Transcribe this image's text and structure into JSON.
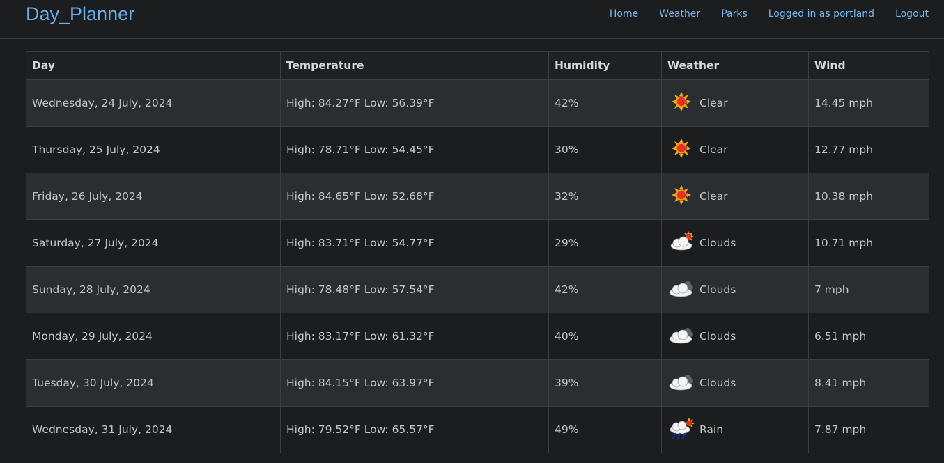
{
  "app": {
    "brand": "Day_Planner",
    "nav": [
      "Home",
      "Weather",
      "Parks",
      "Logged in as portland",
      "Logout"
    ]
  },
  "table": {
    "headers": [
      "Day",
      "Temperature",
      "Humidity",
      "Weather",
      "Wind"
    ],
    "rows": [
      {
        "day": "Wednesday, 24 July, 2024",
        "temp": "High: 84.27°F Low: 56.39°F",
        "humidity": "42%",
        "icon": "sun-icon",
        "weather": "Clear",
        "wind": "14.45 mph"
      },
      {
        "day": "Thursday, 25 July, 2024",
        "temp": "High: 78.71°F Low: 54.45°F",
        "humidity": "30%",
        "icon": "sun-icon",
        "weather": "Clear",
        "wind": "12.77 mph"
      },
      {
        "day": "Friday, 26 July, 2024",
        "temp": "High: 84.65°F Low: 52.68°F",
        "humidity": "32%",
        "icon": "sun-icon",
        "weather": "Clear",
        "wind": "10.38 mph"
      },
      {
        "day": "Saturday, 27 July, 2024",
        "temp": "High: 83.71°F Low: 54.77°F",
        "humidity": "29%",
        "icon": "partly-cloudy-icon",
        "weather": "Clouds",
        "wind": "10.71 mph"
      },
      {
        "day": "Sunday, 28 July, 2024",
        "temp": "High: 78.48°F Low: 57.54°F",
        "humidity": "42%",
        "icon": "cloudy-icon",
        "weather": "Clouds",
        "wind": "7 mph"
      },
      {
        "day": "Monday, 29 July, 2024",
        "temp": "High: 83.17°F Low: 61.32°F",
        "humidity": "40%",
        "icon": "cloudy-icon",
        "weather": "Clouds",
        "wind": "6.51 mph"
      },
      {
        "day": "Tuesday, 30 July, 2024",
        "temp": "High: 84.15°F Low: 63.97°F",
        "humidity": "39%",
        "icon": "cloudy-icon",
        "weather": "Clouds",
        "wind": "8.41 mph"
      },
      {
        "day": "Wednesday, 31 July, 2024",
        "temp": "High: 79.52°F Low: 65.57°F",
        "humidity": "49%",
        "icon": "rain-icon",
        "weather": "Rain",
        "wind": "7.87 mph"
      }
    ]
  },
  "colors": {
    "background": "#1c1d1f",
    "row_alt": "#2b2e31",
    "brand": "#6aaee8",
    "link": "#75b5ea"
  }
}
